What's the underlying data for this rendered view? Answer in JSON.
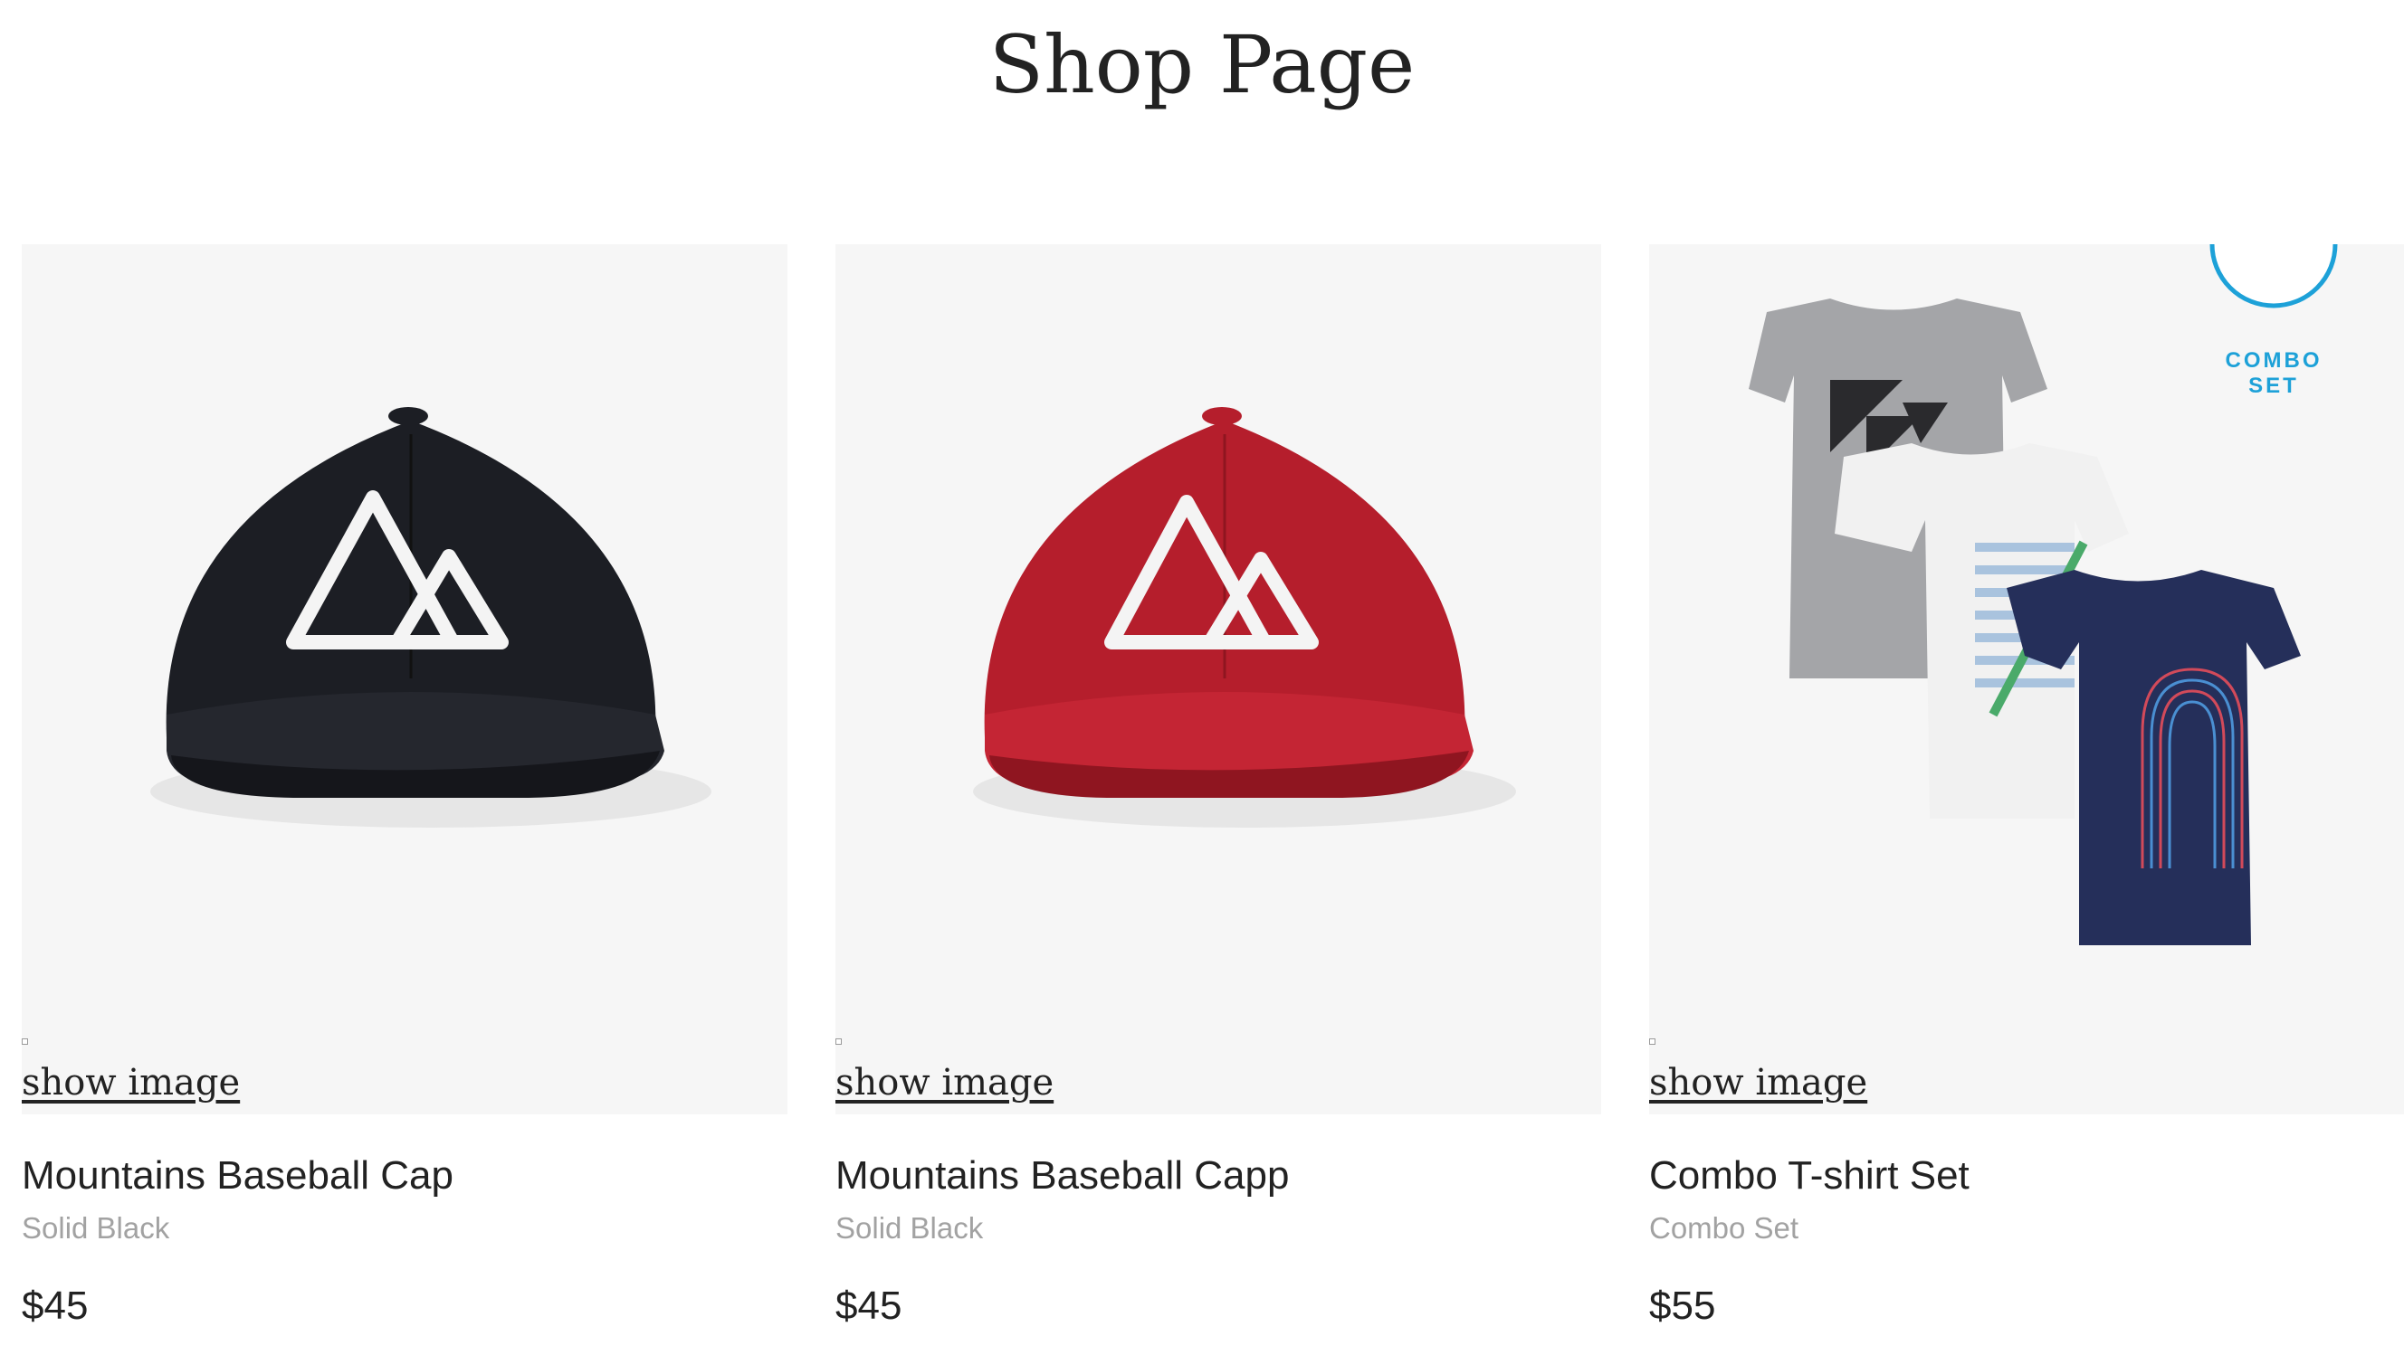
{
  "page": {
    "title": "Shop Page"
  },
  "products": [
    {
      "name": "Mountains Baseball Cap",
      "variant": "Solid Black",
      "price": "$45",
      "show_image_label": "show image",
      "image_icon": "black-baseball-cap-image",
      "cap_color": "#1c1e24"
    },
    {
      "name": "Mountains Baseball Capp",
      "variant": "Solid Black",
      "price": "$45",
      "show_image_label": "show image",
      "image_icon": "red-baseball-cap-image",
      "cap_color": "#b51e2c"
    },
    {
      "name": "Combo T-shirt Set",
      "variant": "Combo Set",
      "price": "$55",
      "show_image_label": "show image",
      "image_icon": "tshirt-combo-image",
      "badge": {
        "line1": "COMBO",
        "line2": "SET",
        "color": "#1da1d8"
      }
    }
  ]
}
